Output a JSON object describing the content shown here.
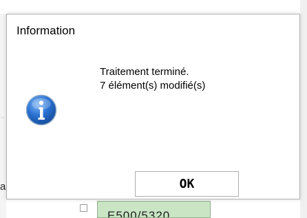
{
  "dialog": {
    "title": "Information",
    "icon": "info-icon",
    "message_lines": [
      "Traitement terminé.",
      "7 élément(s) modifié(s)"
    ],
    "ok_label": "OK"
  },
  "background": {
    "left_fragment": "a",
    "grid_cell_text": "E500/5320"
  },
  "colors": {
    "info_icon_blue": "#1f64c4",
    "grid_cell_green": "#c9e5c4"
  }
}
